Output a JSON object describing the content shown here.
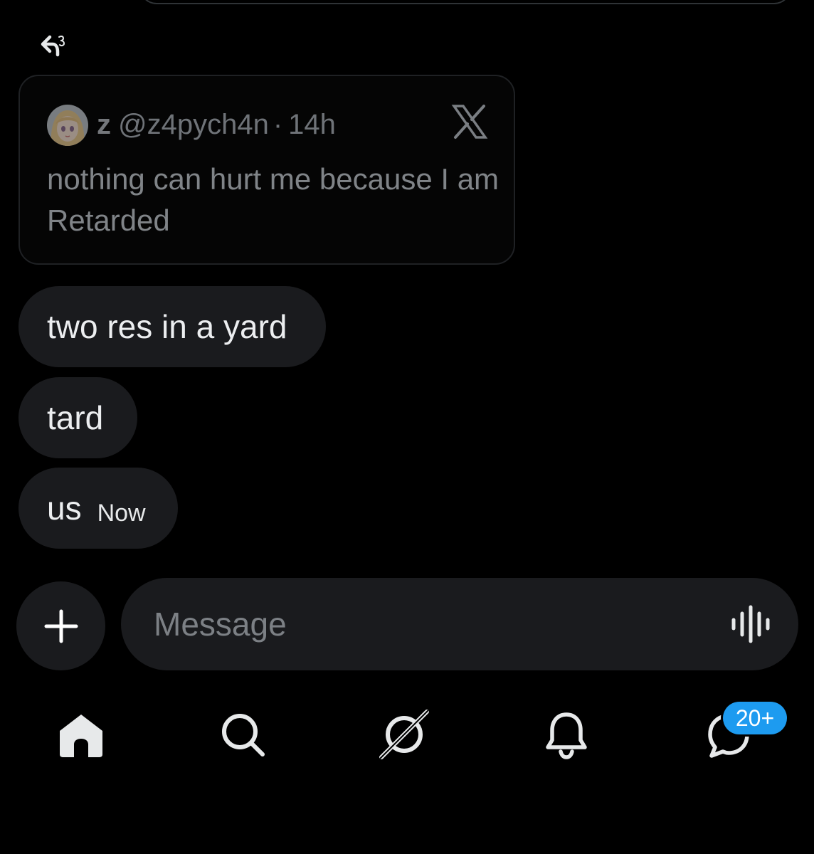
{
  "quoted_post": {
    "name": "z",
    "handle": "@z4pych4n",
    "separator": "·",
    "time": "14h",
    "text": "nothing can hurt me because I am Retarded"
  },
  "messages": [
    {
      "text": "two res in a yard"
    },
    {
      "text": "tard"
    },
    {
      "text": "us",
      "timestamp": "Now"
    }
  ],
  "composer": {
    "placeholder": "Message"
  },
  "nav": {
    "items": [
      "home-icon",
      "search-icon",
      "grok-icon",
      "bell-icon",
      "messages-icon"
    ],
    "messages_badge": "20+"
  },
  "colors": {
    "background": "#000000",
    "bubble": "#1a1b1e",
    "badge": "#1d9bf0"
  }
}
